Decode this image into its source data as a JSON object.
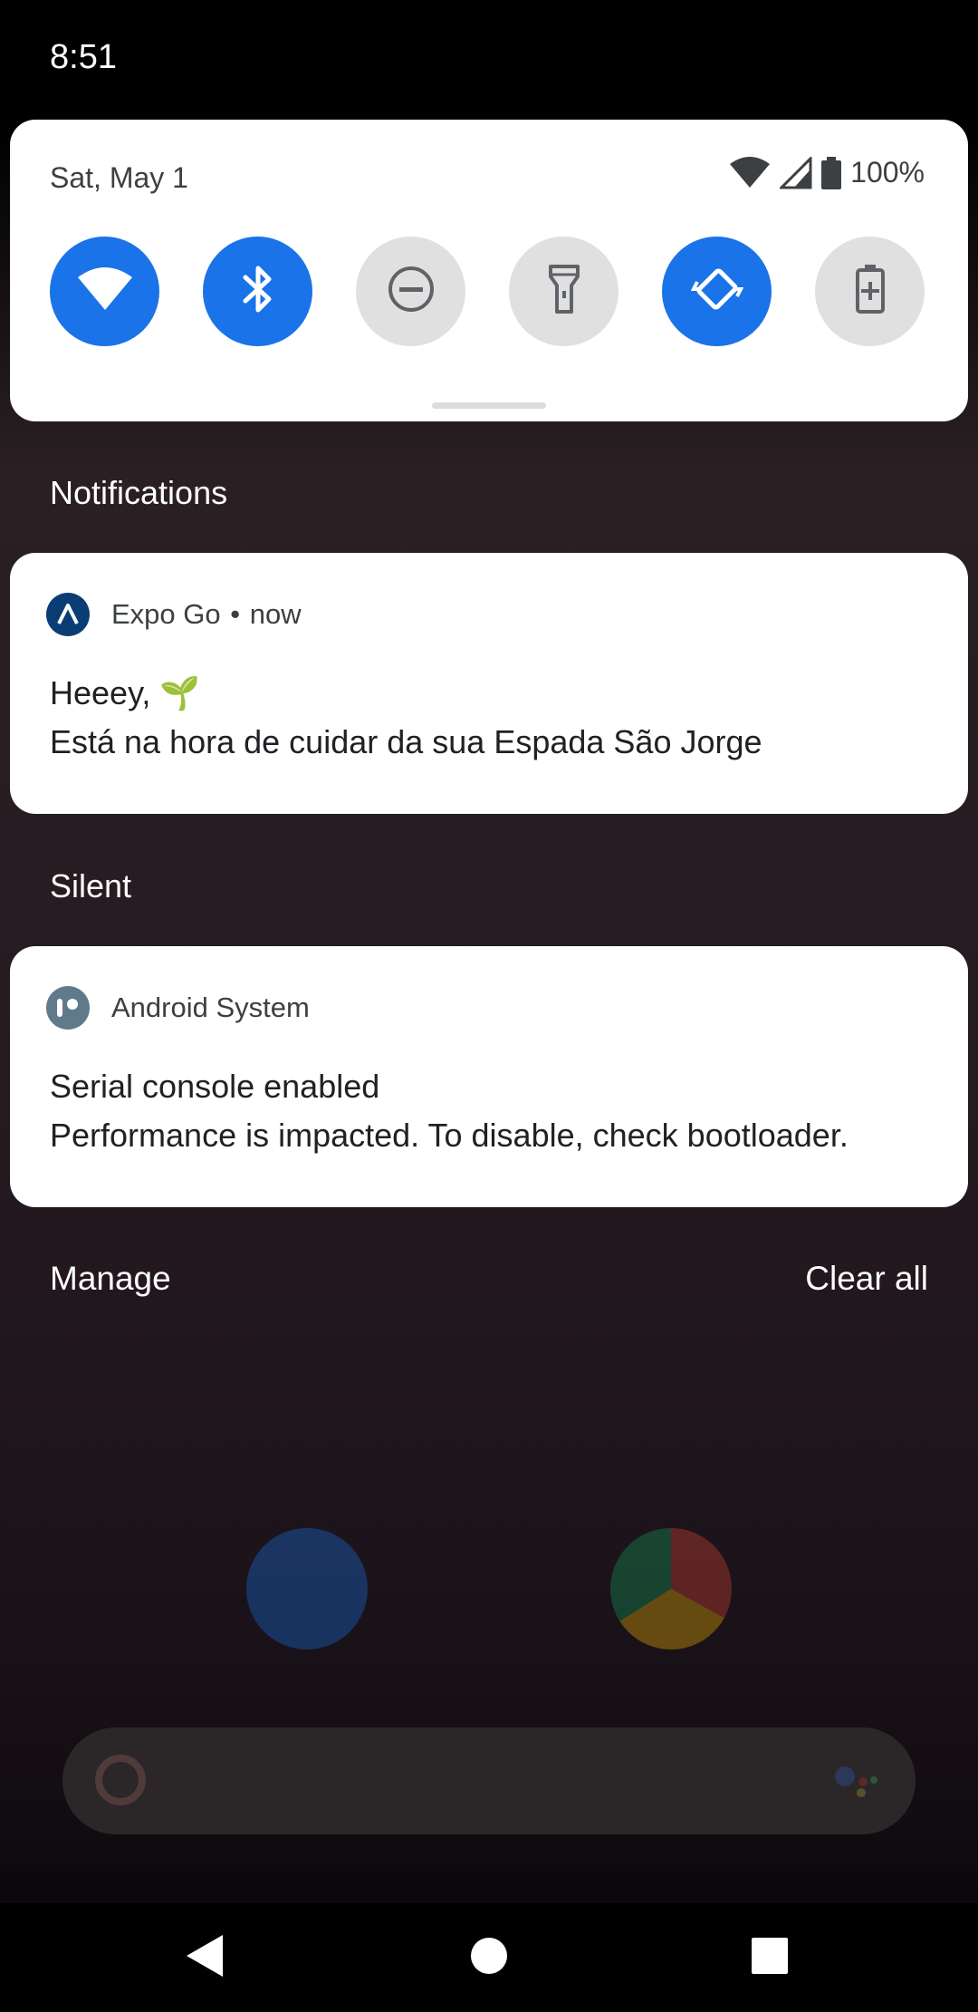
{
  "status_bar": {
    "time": "8:51"
  },
  "quick_settings": {
    "date": "Sat, May 1",
    "battery_percent": "100%",
    "tiles": [
      {
        "icon": "wifi-icon",
        "state": "on"
      },
      {
        "icon": "bluetooth-icon",
        "state": "on"
      },
      {
        "icon": "do-not-disturb-icon",
        "state": "off"
      },
      {
        "icon": "flashlight-icon",
        "state": "off"
      },
      {
        "icon": "auto-rotate-icon",
        "state": "on"
      },
      {
        "icon": "battery-saver-icon",
        "state": "off"
      }
    ],
    "accent_color": "#1a73e8"
  },
  "notifications_header": "Notifications",
  "notifications": [
    {
      "app": "Expo Go",
      "separator": "•",
      "time": "now",
      "title": "Heeey, 🌱",
      "text": "Está na hora de cuidar da sua Espada São Jorge"
    }
  ],
  "silent_header": "Silent",
  "silent_notifications": [
    {
      "app": "Android System",
      "title": "Serial console enabled",
      "text": "Performance is impacted. To disable, check bootloader."
    }
  ],
  "footer": {
    "manage": "Manage",
    "clear_all": "Clear all"
  },
  "navigation": {
    "back": "back-icon",
    "home": "home-icon",
    "recents": "recents-icon"
  }
}
